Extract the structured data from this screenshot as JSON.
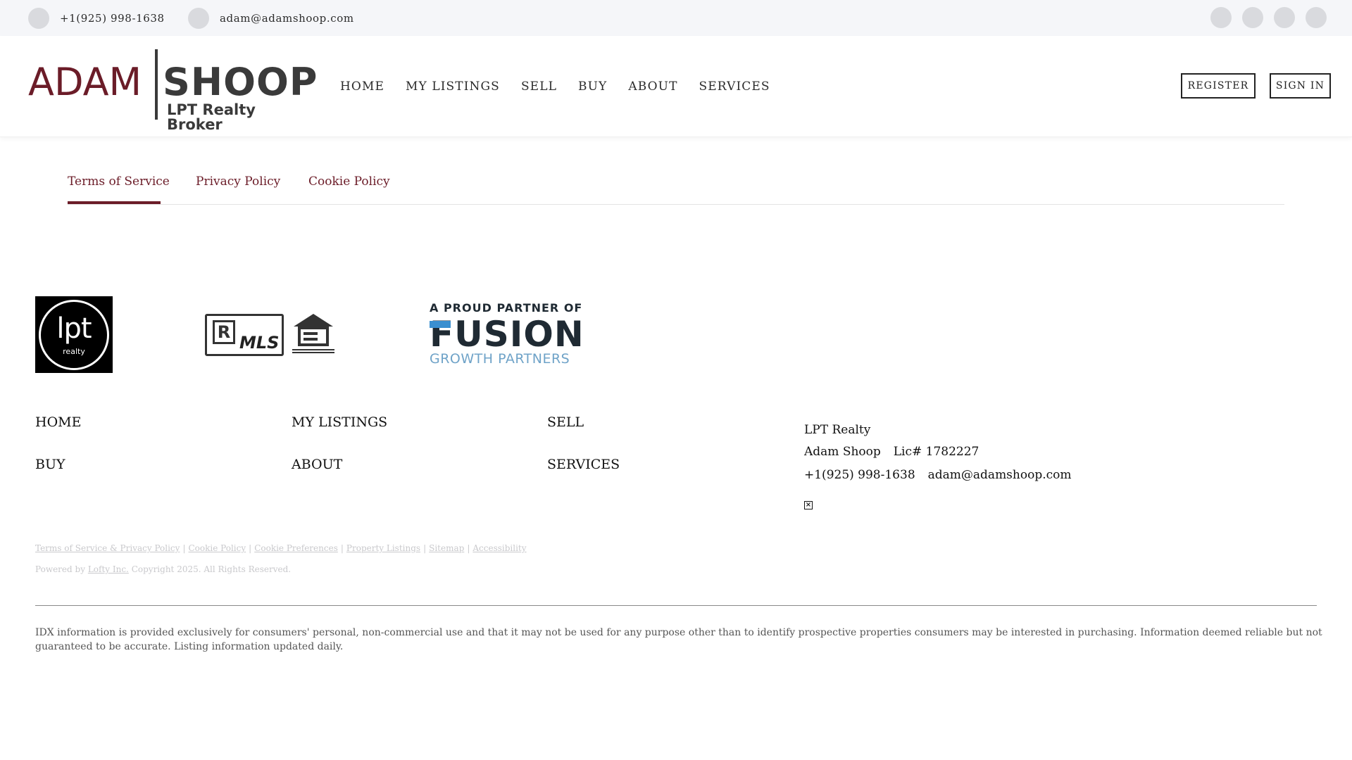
{
  "topbar": {
    "phone": "+1(925) 998-1638",
    "email": "adam@adamshoop.com",
    "social_icons": [
      "social-icon-1",
      "social-icon-2",
      "social-icon-3",
      "social-icon-4"
    ]
  },
  "header": {
    "logo": {
      "part1": "ADAM",
      "part2": "SHOOP",
      "tagline": "LPT Realty Broker"
    },
    "nav": [
      "HOME",
      "MY LISTINGS",
      "SELL",
      "BUY",
      "ABOUT",
      "SERVICES"
    ],
    "register_label": "REGISTER",
    "signin_label": "SIGN IN"
  },
  "tabs": {
    "items": [
      "Terms of Service",
      "Privacy Policy",
      "Cookie Policy"
    ],
    "active": "Terms of Service"
  },
  "partners": {
    "lpt_text": "lpt",
    "lpt_sub": "realty",
    "mls_letter": "R",
    "mls_text": "MLS",
    "fusion_line1": "A PROUD PARTNER OF",
    "fusion_line2": "FUSION",
    "fusion_line3": "GROWTH PARTNERS"
  },
  "footer": {
    "nav": [
      "HOME",
      "MY LISTINGS",
      "SELL",
      "BUY",
      "ABOUT",
      "SERVICES"
    ],
    "company": "LPT Realty",
    "agent_name": "Adam Shoop",
    "license": "Lic# 1782227",
    "phone": "+1(925) 998-1638",
    "email": "adam@adamshoop.com",
    "legal_links": [
      "Terms of Service & Privacy Policy",
      "Cookie Policy",
      "Cookie Preferences",
      "Property Listings",
      "Sitemap",
      "Accessibility"
    ],
    "powered_prefix": "Powered by",
    "powered_link": "Lofty Inc.",
    "copyright": "Copyright 2025. All Rights Reserved.",
    "idx_disclaimer": "IDX information is provided exclusively for consumers' personal, non-commercial use and that it may not be used for any purpose other than to identify prospective properties consumers may be interested in purchasing. Information deemed reliable but not guaranteed to be accurate. Listing information updated daily."
  },
  "colors": {
    "brand": "#6b1c28",
    "dark": "#3a3a3a",
    "topbar_bg": "#f5f6f9",
    "fusion_blue": "#3a8fd0"
  }
}
